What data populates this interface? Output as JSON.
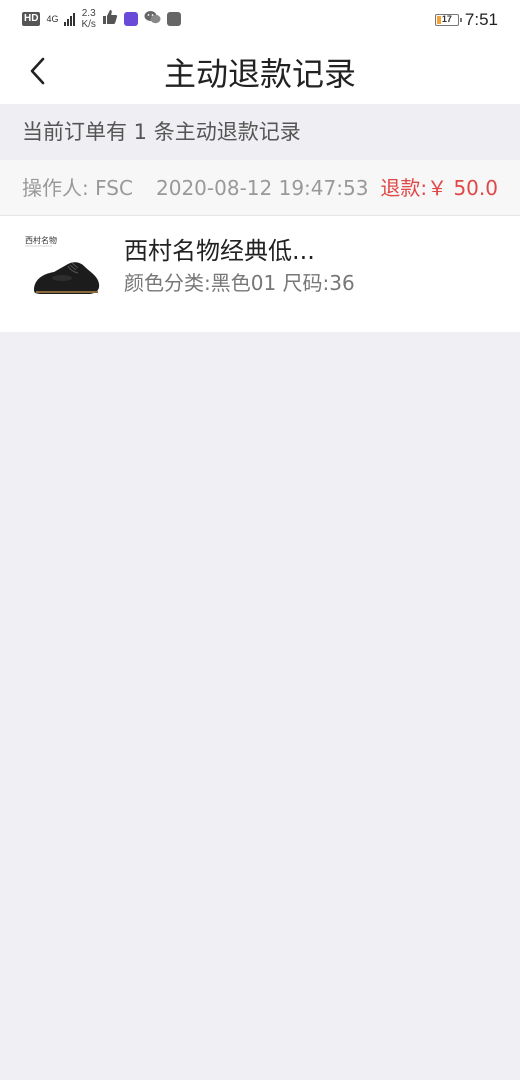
{
  "status_bar": {
    "hd": "HD",
    "network": "4G",
    "net_speed_value": "2.3",
    "net_speed_unit": "K/s",
    "battery_level": "17",
    "time": "7:51"
  },
  "header": {
    "title": "主动退款记录"
  },
  "summary": {
    "text": "当前订单有 1 条主动退款记录"
  },
  "record": {
    "operator": "操作人: FSC",
    "time": "2020-08-12 19:47:53",
    "refund": "退款:￥ 50.0",
    "item": {
      "name": "西村名物经典低...",
      "spec": "颜色分类:黑色01 尺码:36",
      "brand_watermark": "西村名物"
    }
  },
  "colors": {
    "refund_red": "#e04848",
    "background": "#f0f0f4"
  },
  "icons": {
    "back": "chevron-left-icon",
    "thumbs_up": "thumbs-up-icon",
    "chat": "wechat-icon"
  }
}
